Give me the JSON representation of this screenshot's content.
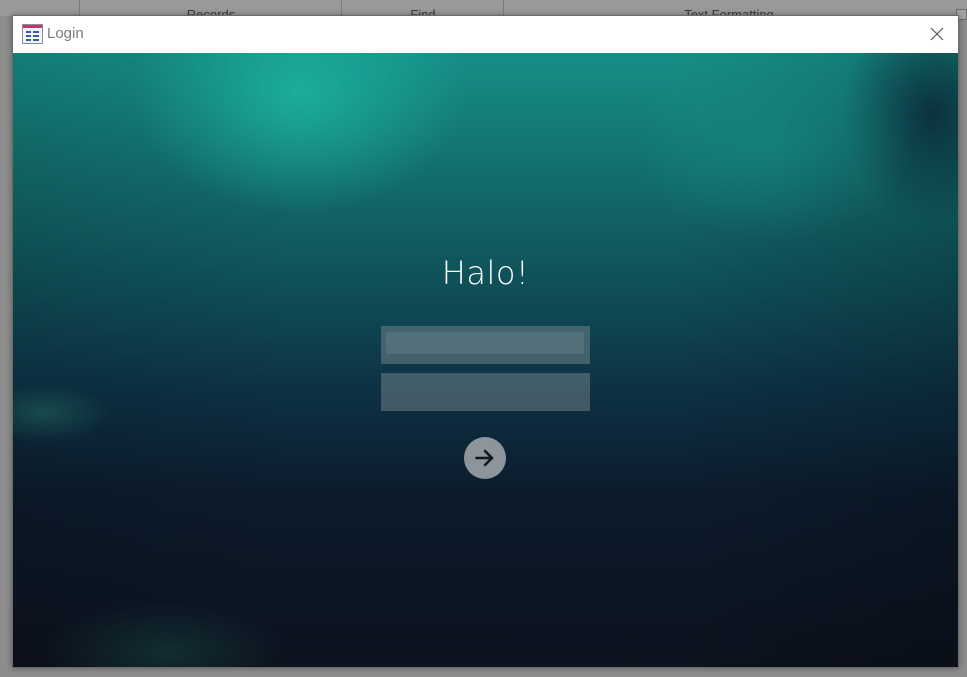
{
  "background_ribbon": {
    "groups": [
      {
        "label": "Records"
      },
      {
        "label": "Find"
      },
      {
        "label": "Text Formatting"
      }
    ]
  },
  "dialog": {
    "title": "Login",
    "title_icon": "form-icon",
    "close_icon": "close-icon"
  },
  "login": {
    "greeting": "Halo!",
    "username": {
      "value": "",
      "placeholder": ""
    },
    "password": {
      "value": "",
      "placeholder": ""
    },
    "submit_icon": "arrow-right-icon"
  },
  "colors": {
    "gradient_top": "#168f86",
    "gradient_bottom": "#0c121e",
    "field_fill": "#5f6b73",
    "button_fill": "#8d959b",
    "greeting_text": "#ffffff"
  }
}
